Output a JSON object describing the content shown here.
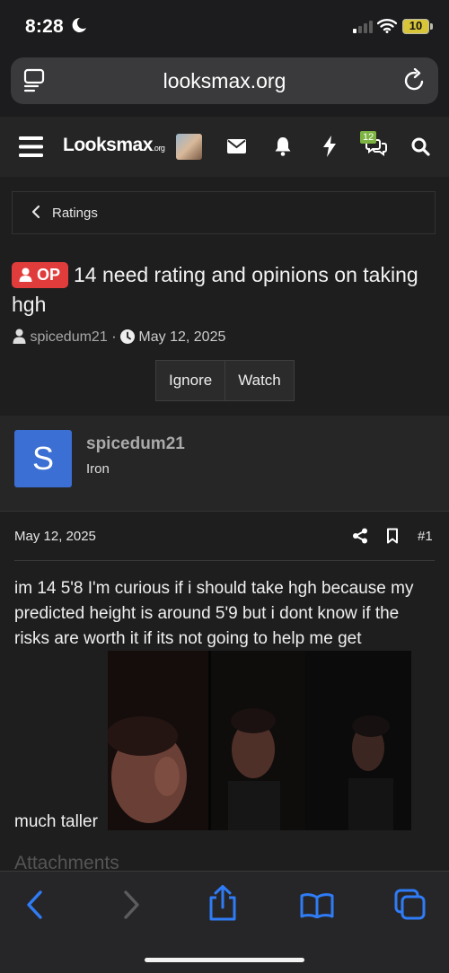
{
  "status": {
    "time": "8:28",
    "battery": "10"
  },
  "browser": {
    "url": "looksmax.org"
  },
  "nav": {
    "logo_main": "Looksmax",
    "logo_suffix": ".org",
    "alerts_count": "12"
  },
  "breadcrumb": {
    "label": "Ratings"
  },
  "thread": {
    "badge": "OP",
    "title": "14 need rating and opinions on taking hgh",
    "author": "spicedum21",
    "separator": "·",
    "date": "May 12, 2025",
    "ignore_label": "Ignore",
    "watch_label": "Watch"
  },
  "post": {
    "avatar_letter": "S",
    "username": "spicedum21",
    "rank": "Iron",
    "date": "May 12, 2025",
    "number": "#1",
    "body_text": "im 14 5'8 I'm curious if i should take hgh because my predicted height is around 5'9 but i dont know if the risks are worth it if its not going to help me get",
    "body_tail": "much taller",
    "attachments_label": "Attachments"
  },
  "colors": {
    "accent": "#2f7cf6",
    "op_badge": "#e03c3c",
    "avatar": "#3b6fd3",
    "alerts_badge": "#7cb342"
  }
}
